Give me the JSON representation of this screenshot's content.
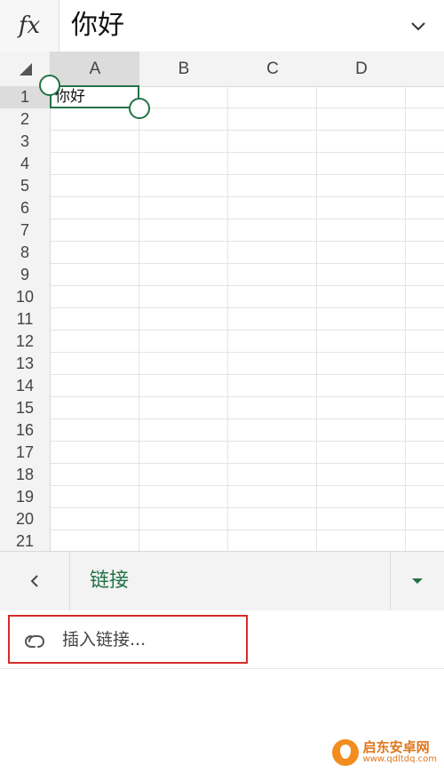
{
  "formula_bar": {
    "fx_label": "fx",
    "value": "你好",
    "expand_icon": "chevron-down-icon"
  },
  "grid": {
    "columns": [
      "A",
      "B",
      "C",
      "D"
    ],
    "rows": [
      "1",
      "2",
      "3",
      "4",
      "5",
      "6",
      "7",
      "8",
      "9",
      "10",
      "11",
      "12",
      "13",
      "14",
      "15",
      "16",
      "17",
      "18",
      "19",
      "20",
      "21"
    ],
    "selected_column": "A",
    "selected_row": "1",
    "cell_a1": "你好",
    "select_all_icon": "triangle-corner-icon"
  },
  "ribbon": {
    "back_icon": "chevron-left-icon",
    "title": "链接",
    "dropdown_icon": "caret-down-icon"
  },
  "commands": {
    "insert_link_label": "插入链接...",
    "insert_link_icon": "link-icon"
  },
  "watermark": {
    "title": "启东安卓网",
    "url": "www.qdltdq.com"
  },
  "colors": {
    "accent_green": "#217346",
    "highlight_red": "#d62a2a"
  }
}
